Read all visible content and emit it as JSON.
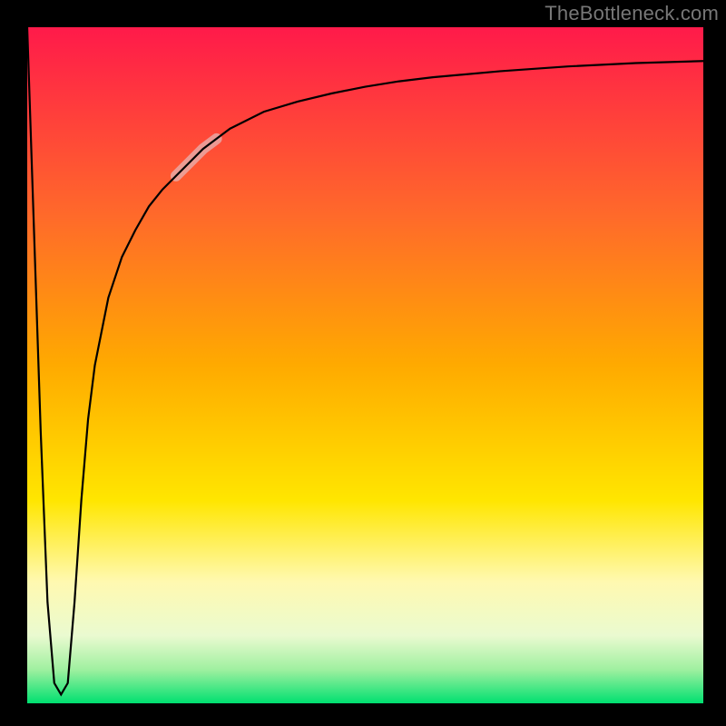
{
  "watermark": "TheBottleneck.com",
  "chart_data": {
    "type": "line",
    "title": "",
    "xlabel": "",
    "ylabel": "",
    "xlim": [
      0,
      100
    ],
    "ylim": [
      0,
      100
    ],
    "grid": false,
    "legend": false,
    "gradient_stops": [
      {
        "offset": 0,
        "color": "#ff1a4a"
      },
      {
        "offset": 0.28,
        "color": "#ff6a2a"
      },
      {
        "offset": 0.5,
        "color": "#ffaa00"
      },
      {
        "offset": 0.7,
        "color": "#ffe600"
      },
      {
        "offset": 0.82,
        "color": "#fff9b0"
      },
      {
        "offset": 0.9,
        "color": "#eafad0"
      },
      {
        "offset": 0.95,
        "color": "#a0f0a0"
      },
      {
        "offset": 1.0,
        "color": "#00e070"
      }
    ],
    "series": [
      {
        "name": "bottleneck-curve",
        "stroke": "#000000",
        "stroke_width": 2.2,
        "x": [
          0,
          1,
          2,
          3,
          4,
          5,
          6,
          7,
          8,
          9,
          10,
          12,
          14,
          16,
          18,
          20,
          22,
          24,
          26,
          28,
          30,
          35,
          40,
          45,
          50,
          55,
          60,
          70,
          80,
          90,
          100
        ],
        "y": [
          100,
          70,
          40,
          15,
          3,
          1.3,
          3,
          15,
          30,
          42,
          50,
          60,
          66,
          70,
          73.5,
          76,
          78,
          80,
          82,
          83.5,
          85,
          87.5,
          89,
          90.2,
          91.2,
          92,
          92.6,
          93.5,
          94.2,
          94.7,
          95
        ]
      },
      {
        "name": "highlight-segment",
        "stroke": "rgba(230,180,180,0.75)",
        "stroke_width": 12,
        "linecap": "round",
        "x": [
          22,
          24,
          26,
          28
        ],
        "y": [
          78,
          80,
          82,
          83.5
        ]
      }
    ]
  }
}
